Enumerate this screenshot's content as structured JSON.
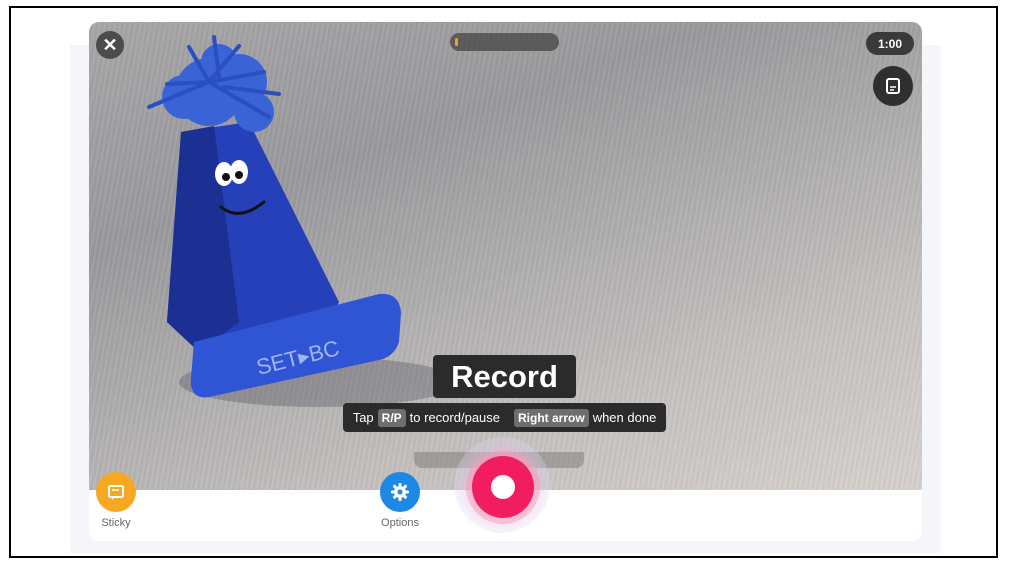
{
  "close": {
    "icon": "close-icon"
  },
  "progress": {
    "fraction": 0.02,
    "color": "#f0a020"
  },
  "timer": {
    "label": "1:00"
  },
  "notes": {
    "icon": "notes-icon"
  },
  "overlay": {
    "title": "Record",
    "hint": {
      "before": "Tap",
      "key1": "R/P",
      "middle": "to record/pause",
      "key2": "Right arrow",
      "after": "when done"
    }
  },
  "scene": {
    "toy_text": "SET▸BC"
  },
  "toolbar": {
    "sticky": {
      "label": "Sticky",
      "icon": "sticky-note-icon",
      "color": "#f7a823"
    },
    "options": {
      "label": "Options",
      "icon": "gear-icon",
      "color": "#1e88e5"
    },
    "record": {
      "icon": "record-icon",
      "color": "#f21d5f"
    }
  }
}
